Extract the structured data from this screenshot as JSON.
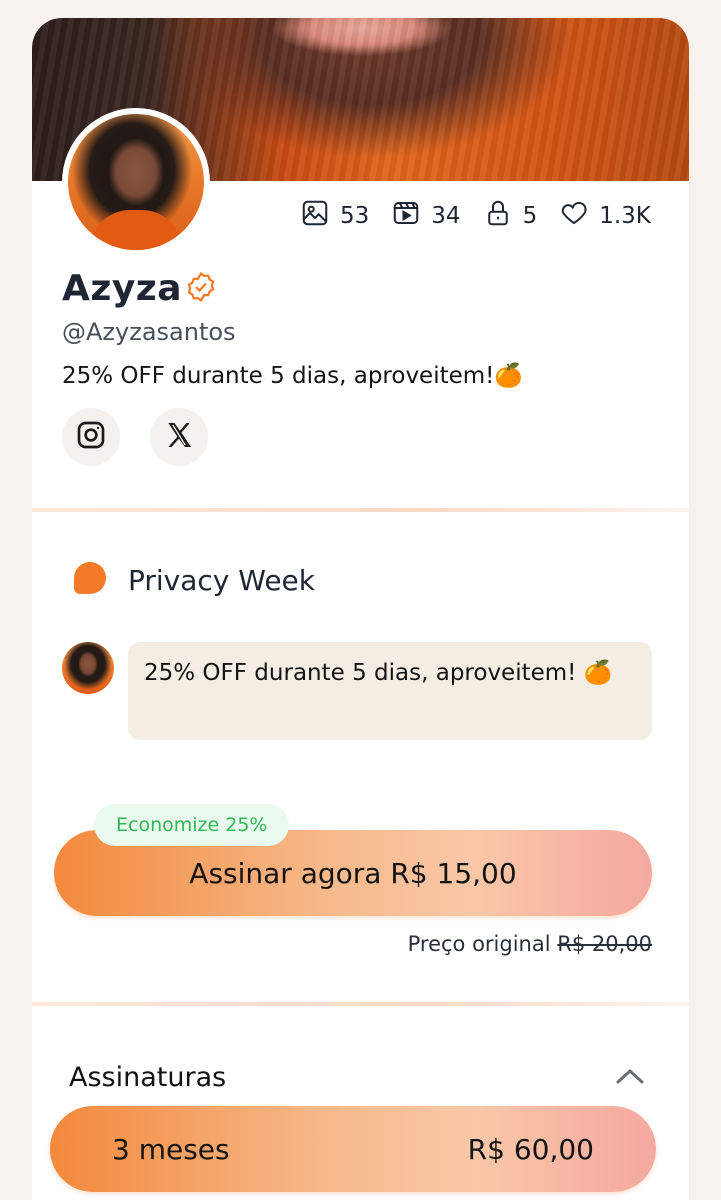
{
  "profile": {
    "name": "Azyza",
    "handle": "@Azyzasantos",
    "bio": "25% OFF durante 5 dias, aproveitem!🍊",
    "stats": {
      "photos": "53",
      "videos": "34",
      "locked": "5",
      "likes": "1.3K"
    },
    "socials": [
      "instagram-icon",
      "x-icon"
    ]
  },
  "campaign": {
    "title": "Privacy Week",
    "message": "25% OFF durante 5 dias, aproveitem! 🍊"
  },
  "offer": {
    "badge": "Economize 25%",
    "button_label": "Assinar agora R$ 15,00",
    "original_label": "Preço original",
    "original_price": "R$ 20,00"
  },
  "subscriptions": {
    "title": "Assinaturas",
    "plans": [
      {
        "duration": "3 meses",
        "price": "R$ 60,00"
      }
    ]
  },
  "colors": {
    "accent": "#f57b2a",
    "badge_text": "#2fb857",
    "text": "#1f2633"
  }
}
